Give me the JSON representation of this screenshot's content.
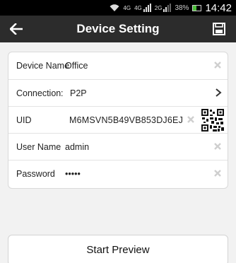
{
  "status_bar": {
    "net1": "4G",
    "net2": "4G",
    "net3": "2G",
    "battery_pct": "38%",
    "battery_level": 0.38,
    "time": "14:42",
    "colors": {
      "battery_fill": "#4cbf3a"
    }
  },
  "header": {
    "title": "Device Setting",
    "back_icon": "arrow-left-icon",
    "save_icon": "floppy-save-icon"
  },
  "form": {
    "device_name": {
      "label": "Device Name",
      "value": "Office"
    },
    "connection": {
      "label": "Connection",
      "separator": ":",
      "value": "P2P"
    },
    "uid": {
      "label": "UID",
      "value": "M6MSVN5B49VB853DJ6EJ"
    },
    "user_name": {
      "label": "User Name",
      "value": "admin"
    },
    "password": {
      "label": "Password",
      "value": "•••••"
    }
  },
  "actions": {
    "start_preview": "Start Preview"
  },
  "colors": {
    "background": "#f2f2f2",
    "action_bar": "#2c2c2c",
    "status_bar": "#000000"
  }
}
